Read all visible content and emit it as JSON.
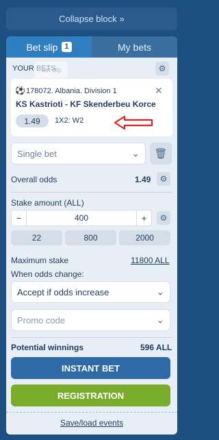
{
  "collapse_label": "Collapse block",
  "collapse_icon": "double-chevron-right-icon",
  "tabs": [
    {
      "label": "Bet slip",
      "count": "1"
    },
    {
      "label": "My bets"
    }
  ],
  "bets_header": "YOUR BETS",
  "ghost_label": "Bet slip",
  "bet": {
    "league": "178072. Albania. Division 1",
    "teams": "KS Kastrioti - KF Skenderbeu Korce",
    "odds": "1.49",
    "market": "1X2: W2"
  },
  "bet_type": "Single bet",
  "overall_odds_label": "Overall odds",
  "overall_odds": "1.49",
  "stake_label": "Stake amount (ALL)",
  "stake_value": "400",
  "stake_presets": [
    "22",
    "800",
    "2000"
  ],
  "max_stake_label": "Maximum stake",
  "max_stake_value": "11800 ALL",
  "odds_change_label": "When odds change:",
  "odds_change_option": "Accept if odds increase",
  "promo_placeholder": "Promo code",
  "potential_label": "Potential winnings",
  "potential_value": "596 ALL",
  "instant_bet_label": "INSTANT BET",
  "registration_label": "REGISTRATION",
  "save_load_label": "Save/load events",
  "colors": {
    "accent_arrow": "#e02020",
    "blue_button": "#2f6aa8",
    "green_button": "#7aac2c"
  }
}
